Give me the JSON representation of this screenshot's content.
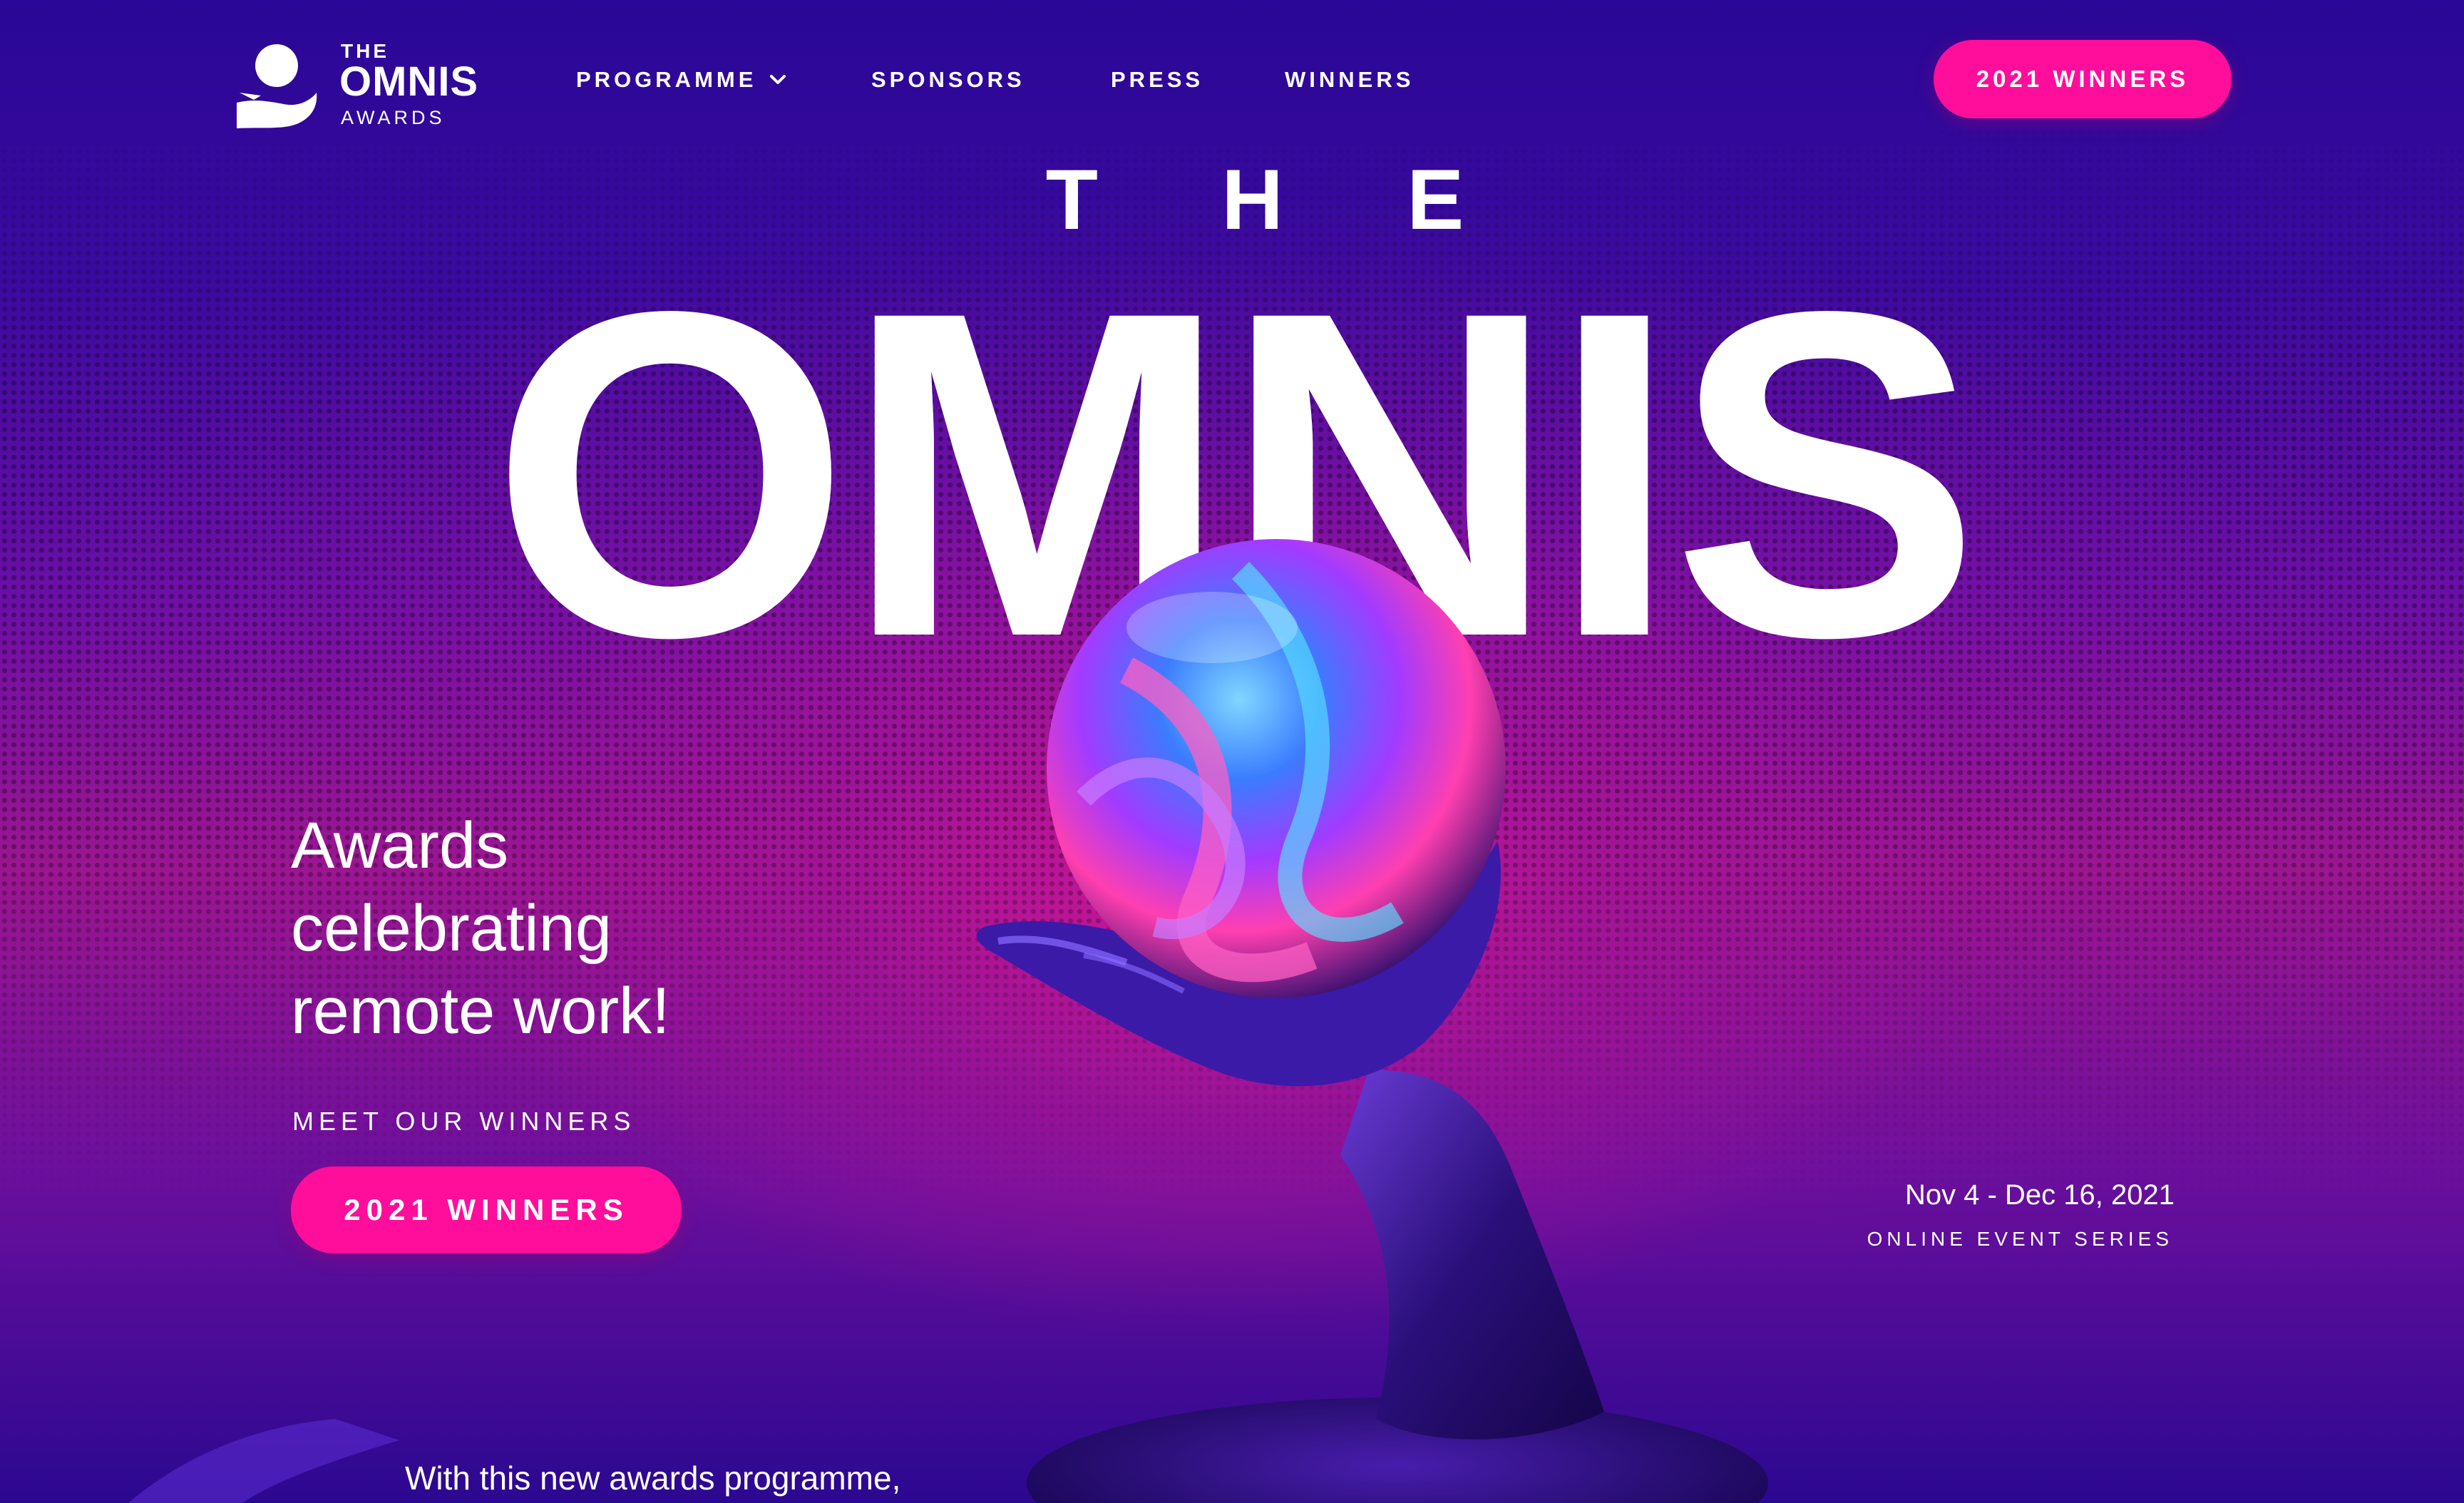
{
  "header": {
    "logo": {
      "the": "THE",
      "omnis": "OMNIS",
      "awards": "AWARDS",
      "icon": "trophy-hand-icon"
    },
    "nav": [
      {
        "label": "PROGRAMME",
        "has_dropdown": true,
        "icon": "chevron-down-icon"
      },
      {
        "label": "SPONSORS"
      },
      {
        "label": "PRESS"
      },
      {
        "label": "WINNERS"
      }
    ],
    "cta_label": "2021 WINNERS"
  },
  "hero": {
    "the": "T H E",
    "title": "OMNIS",
    "tagline": "Awards celebrating remote work!",
    "meet_label": "MEET OUR WINNERS",
    "cta_label": "2021 WINNERS",
    "event_dates": "Nov 4 - Dec 16, 2021",
    "event_type": "ONLINE EVENT SERIES"
  },
  "intro": {
    "text": "With this new awards programme,"
  },
  "colors": {
    "accent": "#ff0d9b",
    "background_top": "#24088f",
    "background_mid": "#9b168f",
    "text": "#ffffff"
  }
}
